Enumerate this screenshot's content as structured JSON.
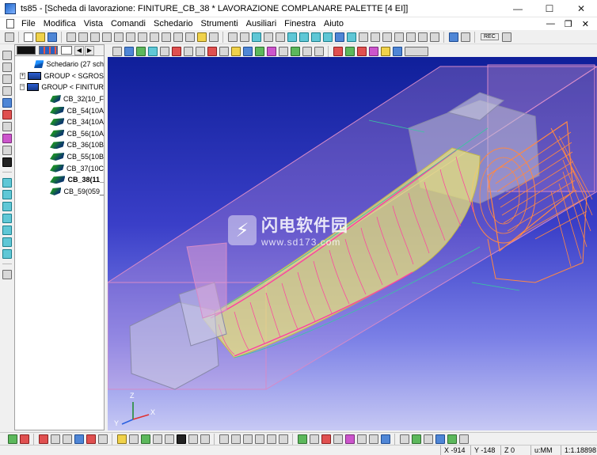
{
  "window": {
    "title": "ts85 - [Scheda  di lavorazione: FINITURE_CB_38 * LAVORAZIONE COMPLANARE PALETTE [4 EI]]",
    "min_glyph": "—",
    "max_glyph": "☐",
    "close_glyph": "✕"
  },
  "menu": {
    "items": [
      "File",
      "Modifica",
      "Vista",
      "Comandi",
      "Schedario",
      "Strumenti",
      "Ausiliari",
      "Finestra",
      "Aiuto"
    ],
    "mdi_min": "—",
    "mdi_restore": "❐",
    "mdi_close": "✕"
  },
  "toolbar": {
    "rec_label": "REC"
  },
  "tree": {
    "left_arrow": "◀",
    "right_arrow": "▶",
    "root": {
      "label": "Schedario (27 sch"
    },
    "groups": [
      {
        "expander": "+",
        "label": "GROUP < SGROS"
      },
      {
        "expander": "−",
        "label": "GROUP < FINITUR"
      }
    ],
    "items": [
      {
        "label": "CB_32(10_F",
        "selected": false
      },
      {
        "label": "CB_54(10A",
        "selected": false
      },
      {
        "label": "CB_34(10A",
        "selected": false
      },
      {
        "label": "CB_56(10A",
        "selected": false
      },
      {
        "label": "CB_36(10B",
        "selected": false
      },
      {
        "label": "CB_55(10B",
        "selected": false
      },
      {
        "label": "CB_37(10C",
        "selected": false
      },
      {
        "label": "CB_38(11_",
        "selected": true
      },
      {
        "label": "CB_59(059_",
        "selected": false
      }
    ]
  },
  "viewport": {
    "axes": {
      "x": "X",
      "y": "Y",
      "z": "Z"
    },
    "watermark": {
      "logo_glyph": "⚡",
      "text": "闪电软件园",
      "url": "www.sd173.com"
    },
    "colors": {
      "toolpath_pink": "#ff3fa0",
      "toolpath_orange": "#ff8844",
      "blade_yellow": "#e8e27a",
      "stock_pink": "#e9a5d8"
    }
  },
  "status": {
    "x": "X -914",
    "y": "Y -148",
    "z": "Z 0",
    "units": "u:MM",
    "scale": "1:1.18898"
  }
}
